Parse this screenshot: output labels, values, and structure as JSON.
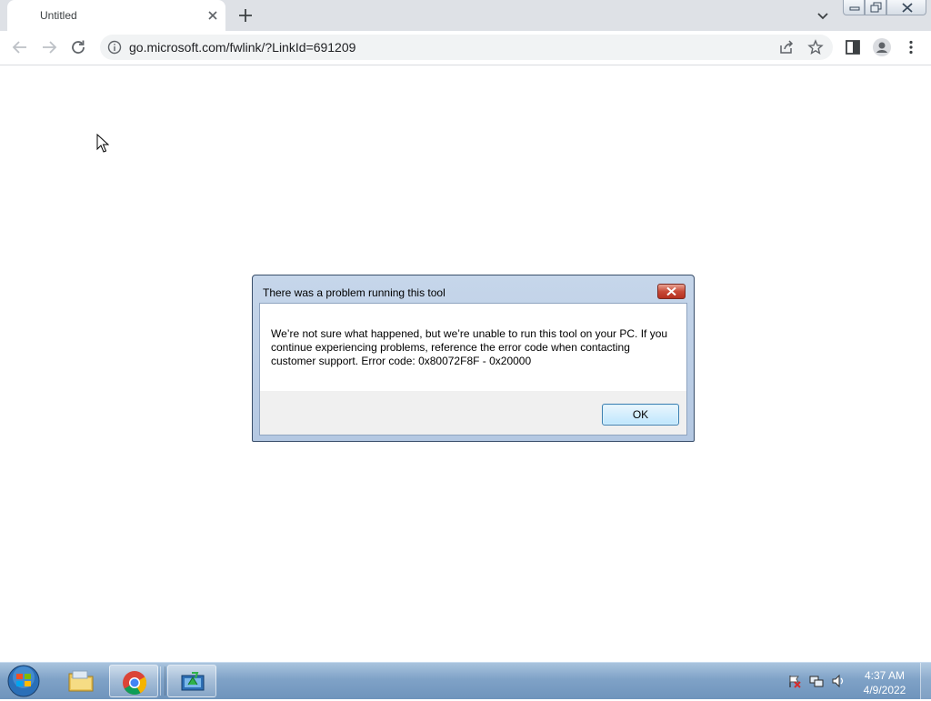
{
  "browser": {
    "tab": {
      "title": "Untitled",
      "close_icon": "close-icon"
    },
    "new_tab_icon": "plus-icon",
    "tab_search_icon": "chevron-down-icon",
    "window_controls": [
      "minimize-icon",
      "restore-icon",
      "close-icon"
    ],
    "toolbar": {
      "back_icon": "arrow-left-icon",
      "forward_icon": "arrow-right-icon",
      "reload_icon": "reload-icon",
      "site_info_icon": "info-icon",
      "url": "go.microsoft.com/fwlink/?LinkId=691209",
      "share_icon": "share-icon",
      "bookmark_icon": "star-icon",
      "side_panel_icon": "side-panel-icon",
      "profile_icon": "profile-icon",
      "menu_icon": "more-vertical-icon"
    }
  },
  "dialog": {
    "title": "There was a problem running this tool",
    "message": "We’re not sure what happened, but we’re unable to run this tool on your PC. If you continue experiencing problems, reference the error code when contacting customer support. Error code: 0x80072F8F - 0x20000",
    "ok_label": "OK"
  },
  "taskbar": {
    "items": [
      "windows-start-icon",
      "file-explorer-icon",
      "chrome-icon",
      "media-creation-tool-icon"
    ],
    "tray": [
      "action-center-flag-icon",
      "network-icon",
      "volume-icon"
    ],
    "time": "4:37 AM",
    "date": "4/9/2022"
  },
  "colors": {
    "tabstrip": "#dee1e6",
    "omnibox": "#f1f3f4",
    "dialog_frame": "#b4c8e2",
    "taskbar": "#7fa2c7"
  }
}
